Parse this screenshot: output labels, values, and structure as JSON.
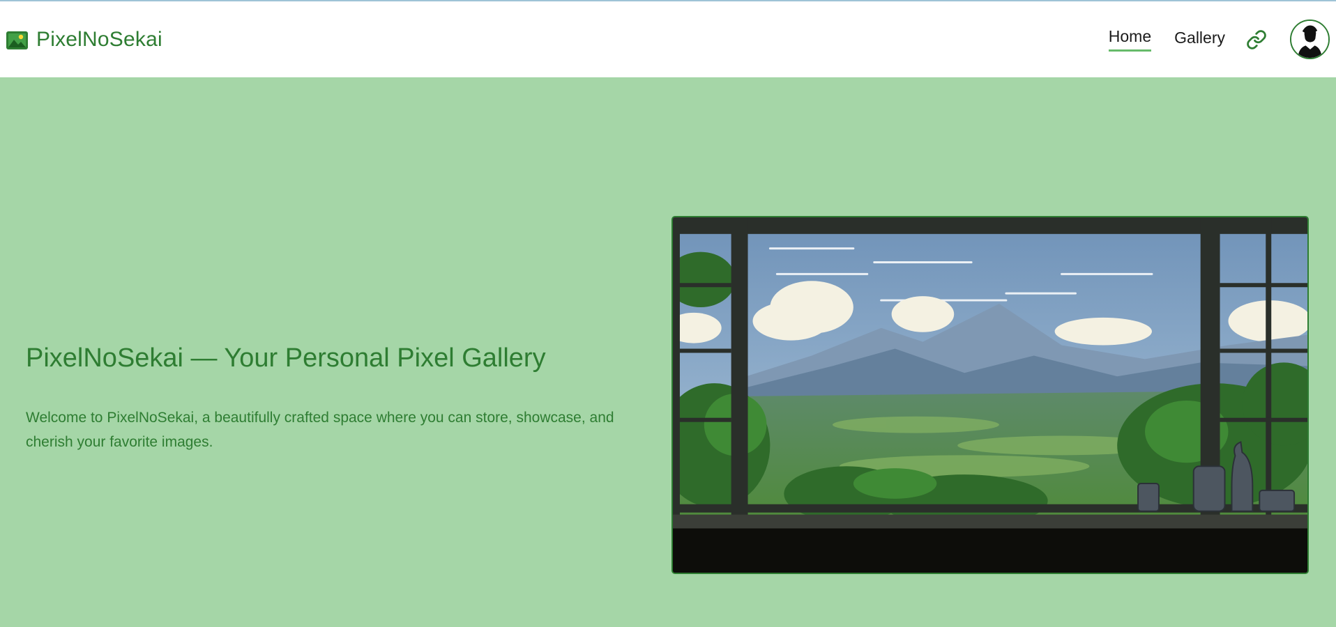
{
  "header": {
    "brand_name": "PixelNoSekai",
    "brand_icon": "image-icon",
    "nav": {
      "home_label": "Home",
      "gallery_label": "Gallery",
      "link_icon": "link-icon"
    },
    "avatar_icon": "user-avatar"
  },
  "hero": {
    "title": "PixelNoSekai — Your Personal Pixel Gallery",
    "description": "Welcome to PixelNoSekai, a beautifully crafted space where you can store, showcase, and cherish your favorite images.",
    "image_subject": "window view of mountains and green valley"
  },
  "colors": {
    "accent": "#2e7d32",
    "background": "#a5d6a7",
    "active_underline": "#66bb6a"
  }
}
